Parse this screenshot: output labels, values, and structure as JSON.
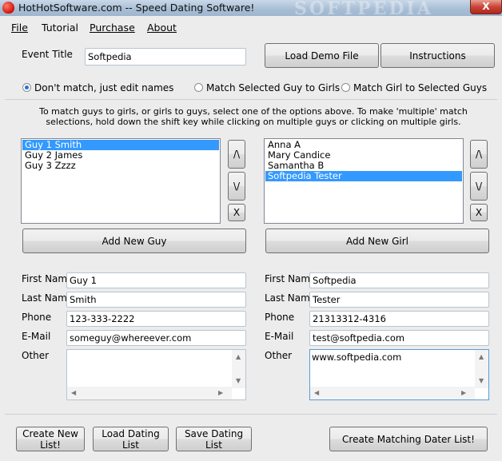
{
  "window": {
    "title": "HotHotSoftware.com -- Speed Dating Software!",
    "close": "X",
    "watermark": "SOFTPEDIA"
  },
  "menu": [
    "File",
    "Tutorial",
    "Purchase",
    "About"
  ],
  "event": {
    "label": "Event Title",
    "value": "Softpedia"
  },
  "buttons": {
    "load_demo": "Load Demo File",
    "instructions": "Instructions",
    "add_guy": "Add New Guy",
    "add_girl": "Add New Girl",
    "create_list": "Create New List!",
    "load_list": "Load Dating List",
    "save_list": "Save Dating List",
    "create_matching": "Create Matching Dater List!",
    "up": "/\\",
    "down": "\\/",
    "remove": "X"
  },
  "modes": [
    {
      "label": "Don't match, just edit names",
      "selected": true
    },
    {
      "label": "Match Selected Guy to Girls",
      "selected": false
    },
    {
      "label": "Match Girl to Selected Guys",
      "selected": false
    }
  ],
  "instructions_text": "To match guys to girls, or girls to guys, select one of the options above. To make 'multiple' match selections, hold down the shift key while clicking on multiple guys or clicking on multiple girls.",
  "guys": {
    "items": [
      {
        "name": "Guy 1 Smith",
        "selected": true
      },
      {
        "name": "Guy 2 James",
        "selected": false
      },
      {
        "name": "Guy 3 Zzzz",
        "selected": false
      }
    ]
  },
  "girls": {
    "items": [
      {
        "name": "Anna A",
        "selected": false
      },
      {
        "name": "Mary Candice",
        "selected": false
      },
      {
        "name": "Samantha B",
        "selected": false
      },
      {
        "name": "Softpedia Tester",
        "selected": true
      }
    ]
  },
  "labels": {
    "first": "First Name",
    "last": "Last Name",
    "phone": "Phone",
    "email": "E-Mail",
    "other": "Other"
  },
  "guy_detail": {
    "first": "Guy 1",
    "last": "Smith",
    "phone": "123-333-2222",
    "email": "someguy@whereever.com",
    "other": ""
  },
  "girl_detail": {
    "first": "Softpedia",
    "last": "Tester",
    "phone": "21313312-4316",
    "email": "test@softpedia.com",
    "other": "www.softpedia.com"
  },
  "colors": {
    "selection": "#3399ff",
    "close": "#c9463a",
    "titlebar": "#a9bfd6"
  }
}
